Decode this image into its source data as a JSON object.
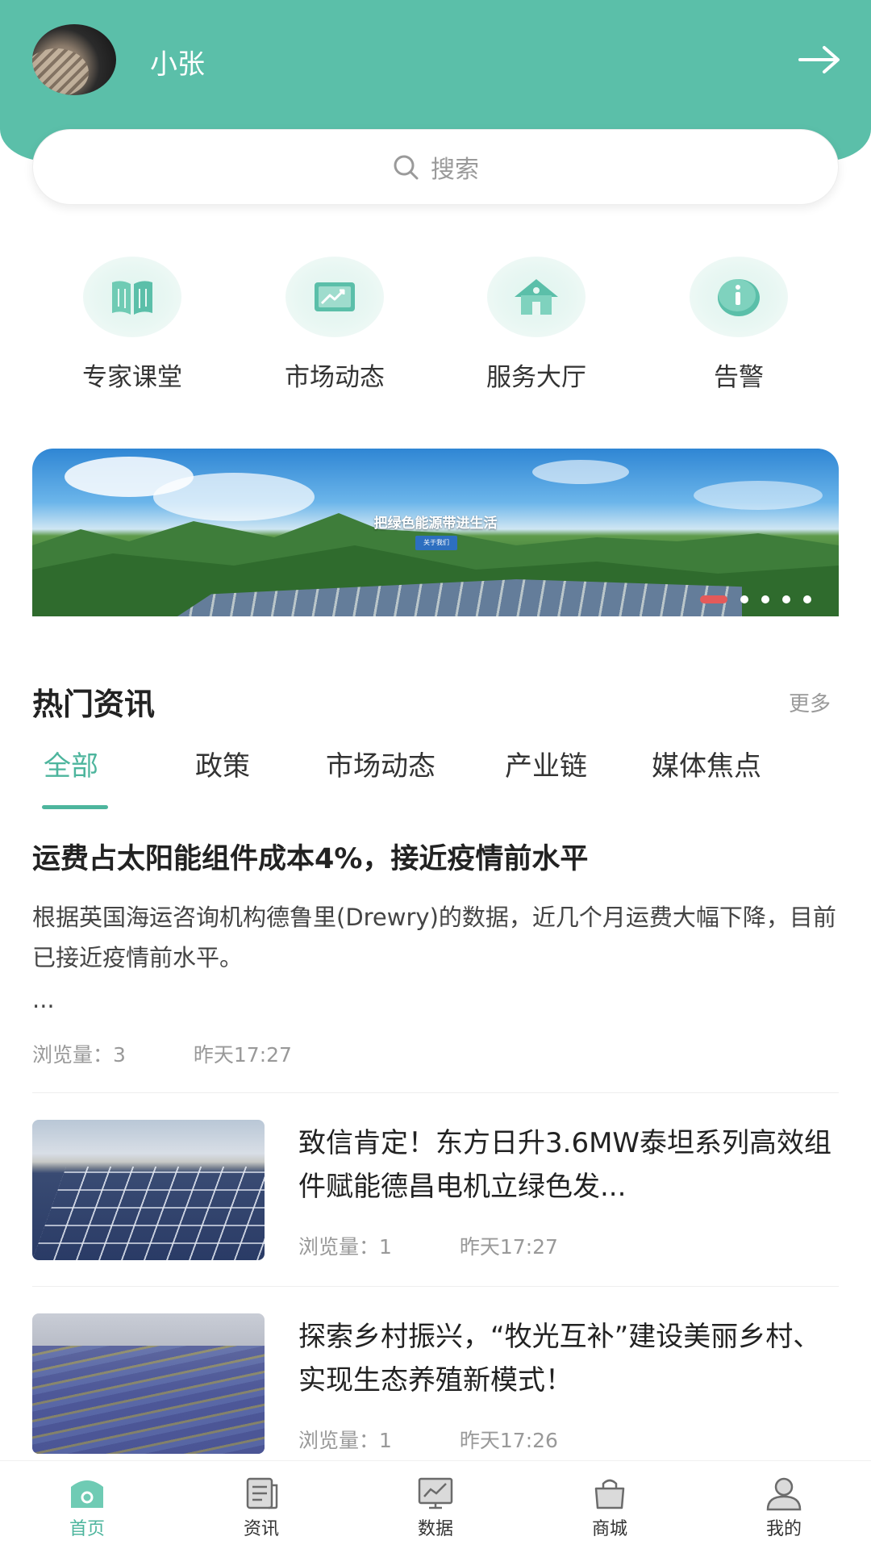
{
  "header": {
    "username": "小张"
  },
  "search": {
    "placeholder": "搜索"
  },
  "quick_menu": [
    {
      "label": "专家课堂",
      "icon": "book-icon"
    },
    {
      "label": "市场动态",
      "icon": "market-chart-icon"
    },
    {
      "label": "服务大厅",
      "icon": "home-service-icon"
    },
    {
      "label": "告警",
      "icon": "info-alert-icon"
    }
  ],
  "banner": {
    "title": "把绿色能源带进生活",
    "button": "关于我们",
    "slide_count": 5,
    "active_slide": 1
  },
  "news_section": {
    "title": "热门资讯",
    "more": "更多",
    "tabs": [
      "全部",
      "政策",
      "市场动态",
      "产业链",
      "媒体焦点"
    ],
    "active_tab": 0
  },
  "featured": {
    "title": "运费占太阳能组件成本4%，接近疫情前水平",
    "body": "根据英国海运咨询机构德鲁里(Drewry)的数据，近几个月运费大幅下降，目前已接近疫情前水平。",
    "ellipsis": "...",
    "views": "浏览量：3",
    "time": "昨天17:27"
  },
  "articles": [
    {
      "title": "致信肯定！东方日升3.6MW泰坦系列高效组件赋能德昌电机立绿色发...",
      "views": "浏览量：1",
      "time": "昨天17:27"
    },
    {
      "title": "探索乡村振兴，“牧光互补”建设美丽乡村、实现生态养殖新模式！",
      "views": "浏览量：1",
      "time": "昨天17:26"
    }
  ],
  "bottom_nav": [
    {
      "label": "首页",
      "icon": "home-icon",
      "active": true
    },
    {
      "label": "资讯",
      "icon": "news-icon",
      "active": false
    },
    {
      "label": "数据",
      "icon": "data-chart-icon",
      "active": false
    },
    {
      "label": "商城",
      "icon": "shop-bag-icon",
      "active": false
    },
    {
      "label": "我的",
      "icon": "user-icon",
      "active": false
    }
  ],
  "colors": {
    "header": "#5bbfa9",
    "accent": "#4db59d",
    "slide_active": "#e45a5a"
  }
}
